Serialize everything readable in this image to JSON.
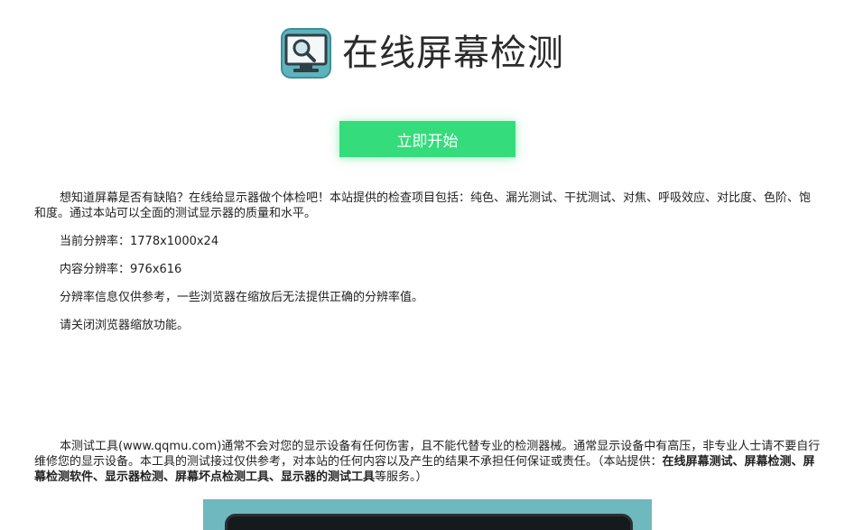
{
  "header": {
    "title": "在线屏幕检测",
    "logo_icon": "monitor-magnifier-icon"
  },
  "actions": {
    "start_label": "立即开始"
  },
  "info": {
    "intro": "想知道屏幕是否有缺陷？在线给显示器做个体检吧！本站提供的检查项目包括：纯色、漏光测试、干扰测试、对焦、呼吸效应、对比度、色阶、饱和度。通过本站可以全面的测试显示器的质量和水平。",
    "current_resolution": "当前分辨率：1778x1000x24",
    "content_resolution": "内容分辨率：976x616",
    "resolution_note": "分辨率信息仅供参考，一些浏览器在缩放后无法提供正确的分辨率值。",
    "zoom_note": "请关闭浏览器缩放功能。"
  },
  "disclaimer": {
    "text": "本测试工具(www.qqmu.com)通常不会对您的显示设备有任何伤害，且不能代替专业的检测器械。通常显示设备中有高压，非专业人士请不要自行维修您的显示设备。本工具的测试接过仅供参考，对本站的任何内容以及产生的结果不承担任何保证或责任。（本站提供：",
    "services": "在线屏幕测试、屏幕检测、屏幕检测软件、显示器检测、屏幕坏点检测工具、显示器的测试工具",
    "suffix": "等服务。）"
  },
  "colors": {
    "accent": "#34dc7c",
    "logo_bg": "#5fb3bd",
    "preview_bg": "#6fb8bf"
  }
}
